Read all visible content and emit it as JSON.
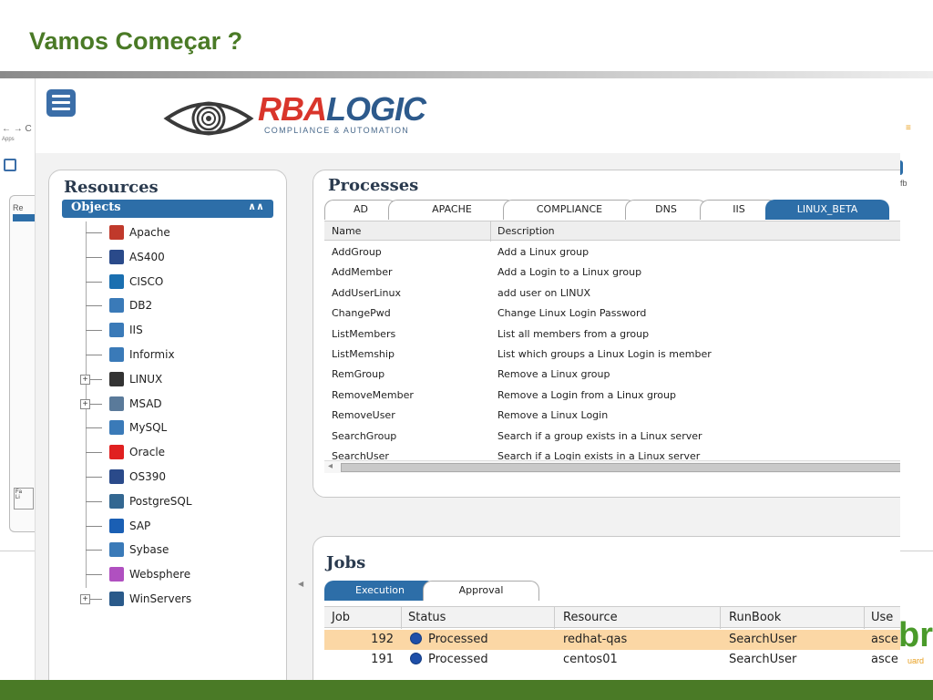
{
  "slide": {
    "title": "Vamos Começar ?",
    "brand_br": "br",
    "brand_ward": "uard"
  },
  "background_browser": {
    "nav": "← → C",
    "apps": "Apps",
    "panel_label": "Re",
    "small_box_1": "Fa",
    "small_box_2": "Li",
    "right_fragment": "fb"
  },
  "app": {
    "logo": {
      "rba": "RBA",
      "logic": "LOGIC",
      "subtitle": "COMPLIANCE & AUTOMATION"
    },
    "resources": {
      "title": "Resources",
      "objects_label": "Objects",
      "items": [
        {
          "label": "Apache",
          "icon": "apache-feather-icon",
          "expandable": false,
          "color": "#c0392b"
        },
        {
          "label": "AS400",
          "icon": "ibm-as400-icon",
          "expandable": false,
          "color": "#2a4a8a"
        },
        {
          "label": "CISCO",
          "icon": "cisco-icon",
          "expandable": false,
          "color": "#1a6fb0"
        },
        {
          "label": "DB2",
          "icon": "database-server-icon",
          "expandable": false,
          "color": "#3a7ab8"
        },
        {
          "label": "IIS",
          "icon": "iis-server-icon",
          "expandable": false,
          "color": "#3a7ab8"
        },
        {
          "label": "Informix",
          "icon": "database-server-icon",
          "expandable": false,
          "color": "#3a7ab8"
        },
        {
          "label": "LINUX",
          "icon": "linux-tux-icon",
          "expandable": true,
          "color": "#333333"
        },
        {
          "label": "MSAD",
          "icon": "users-group-icon",
          "expandable": true,
          "color": "#5a7a9a"
        },
        {
          "label": "MySQL",
          "icon": "database-server-icon",
          "expandable": false,
          "color": "#3a7ab8"
        },
        {
          "label": "Oracle",
          "icon": "oracle-icon",
          "expandable": false,
          "color": "#e02020"
        },
        {
          "label": "OS390",
          "icon": "ibm-os390-icon",
          "expandable": false,
          "color": "#2a4a8a"
        },
        {
          "label": "PostgreSQL",
          "icon": "postgresql-elephant-icon",
          "expandable": false,
          "color": "#336791"
        },
        {
          "label": "SAP",
          "icon": "sap-icon",
          "expandable": false,
          "color": "#1a5fb4"
        },
        {
          "label": "Sybase",
          "icon": "database-server-icon",
          "expandable": false,
          "color": "#3a7ab8"
        },
        {
          "label": "Websphere",
          "icon": "websphere-globe-icon",
          "expandable": false,
          "color": "#b050c0"
        },
        {
          "label": "WinServers",
          "icon": "windows-server-icon",
          "expandable": true,
          "color": "#2a5a8a"
        }
      ]
    },
    "processes": {
      "title": "Processes",
      "tabs": [
        "AD",
        "APACHE",
        "COMPLIANCE",
        "DNS",
        "IIS",
        "LINUX_BETA"
      ],
      "active_tab": "LINUX_BETA",
      "columns": [
        "Name",
        "Description"
      ],
      "rows": [
        [
          "AddGroup",
          "Add a Linux group"
        ],
        [
          "AddMember",
          "Add a Login to a Linux group"
        ],
        [
          "AddUserLinux",
          "add user on LINUX"
        ],
        [
          "ChangePwd",
          "Change Linux Login Password"
        ],
        [
          "ListMembers",
          "List all members from a group"
        ],
        [
          "ListMemship",
          "List which groups a Linux Login is member"
        ],
        [
          "RemGroup",
          "Remove a Linux group"
        ],
        [
          "RemoveMember",
          "Remove a Login from a Linux group"
        ],
        [
          "RemoveUser",
          "Remove a Linux Login"
        ],
        [
          "SearchGroup",
          "Search if a group exists in a Linux server"
        ],
        [
          "SearchUser",
          "Search if a Login exists in a Linux server"
        ]
      ]
    },
    "jobs": {
      "title": "Jobs",
      "tabs": [
        "Execution",
        "Approval"
      ],
      "active_tab": "Execution",
      "columns": [
        "Job",
        "Status",
        "Resource",
        "RunBook",
        "Use"
      ],
      "rows": [
        {
          "job": "192",
          "status": "Processed",
          "resource": "redhat-qas",
          "runbook": "SearchUser",
          "user": "asce",
          "selected": true
        },
        {
          "job": "191",
          "status": "Processed",
          "resource": "centos01",
          "runbook": "SearchUser",
          "user": "asce",
          "selected": false
        }
      ]
    }
  }
}
